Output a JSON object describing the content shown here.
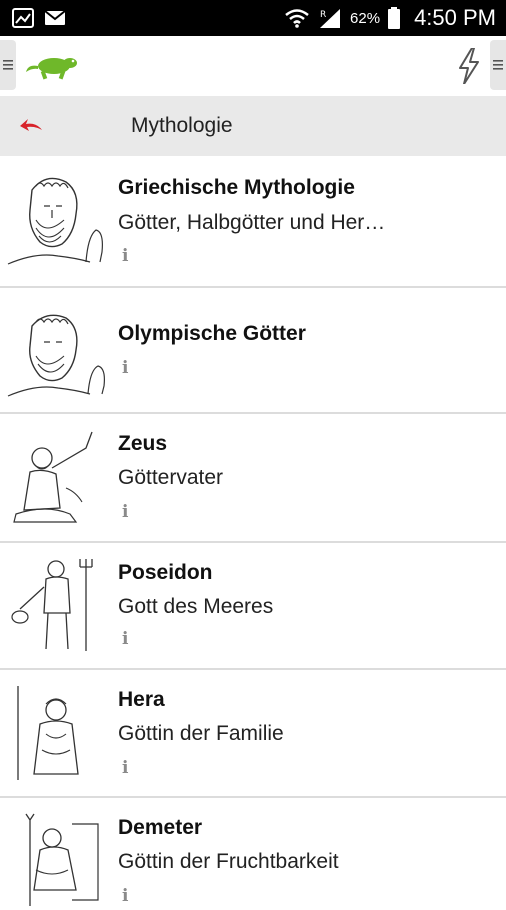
{
  "status_bar": {
    "battery_percent": "62%",
    "time": "4:50 PM"
  },
  "toolbar": {
    "logo_icon": "lizard-icon",
    "flash_icon": "lightning-icon"
  },
  "navbar": {
    "title": "Mythologie"
  },
  "list": {
    "items": [
      {
        "title": "Griechische Mythologie",
        "subtitle": "Götter, Halbgötter und Her…",
        "info": "i"
      },
      {
        "title": "Olympische Götter",
        "subtitle": "",
        "info": "i"
      },
      {
        "title": "Zeus",
        "subtitle": "Göttervater",
        "info": "i"
      },
      {
        "title": "Poseidon",
        "subtitle": "Gott des Meeres",
        "info": "i"
      },
      {
        "title": "Hera",
        "subtitle": "Göttin der Familie",
        "info": "i"
      },
      {
        "title": "Demeter",
        "subtitle": "Göttin der Fruchtbarkeit",
        "info": "i"
      }
    ]
  },
  "colors": {
    "accent_green": "#6fb82a",
    "back_arrow_red": "#d8232a",
    "navbar_bg": "#e9e9e9"
  }
}
